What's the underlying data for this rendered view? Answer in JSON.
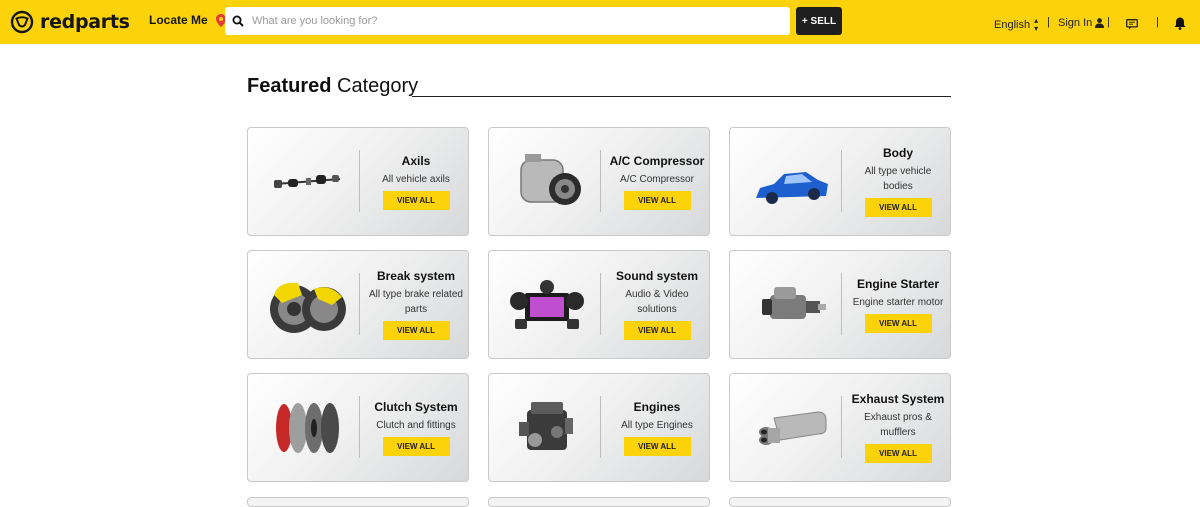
{
  "header": {
    "logo_text": "redparts",
    "locate_label": "Locate Me",
    "search_placeholder": "What are you looking for?",
    "sell_label": "+ SELL",
    "language": "English",
    "signin_label": "Sign In",
    "divider": "|"
  },
  "colors": {
    "brand_yellow": "#fcd20a",
    "dark": "#1f1f1f",
    "pin_red": "#e53935"
  },
  "section": {
    "title_bold": "Featured",
    "title_rest": "Category"
  },
  "categories": [
    {
      "name": "Axils",
      "desc": "All vehicle axils",
      "button": "VIEW ALL",
      "icon": "axle-image"
    },
    {
      "name": "A/C Compressor",
      "desc": "A/C Compressor",
      "button": "VIEW ALL",
      "icon": "ac-compressor-image"
    },
    {
      "name": "Body",
      "desc": "All type vehicle bodies",
      "button": "VIEW ALL",
      "icon": "car-body-image"
    },
    {
      "name": "Break system",
      "desc": "All type brake related parts",
      "button": "VIEW ALL",
      "icon": "brake-image"
    },
    {
      "name": "Sound system",
      "desc": "Audio & Video solutions",
      "button": "VIEW ALL",
      "icon": "sound-system-image"
    },
    {
      "name": "Engine Starter",
      "desc": "Engine starter motor",
      "button": "VIEW ALL",
      "icon": "starter-motor-image"
    },
    {
      "name": "Clutch System",
      "desc": "Clutch and fittings",
      "button": "VIEW ALL",
      "icon": "clutch-image"
    },
    {
      "name": "Engines",
      "desc": "All type Engines",
      "button": "VIEW ALL",
      "icon": "engine-image"
    },
    {
      "name": "Exhaust System",
      "desc": "Exhaust pros & mufflers",
      "button": "VIEW ALL",
      "icon": "exhaust-image"
    }
  ]
}
